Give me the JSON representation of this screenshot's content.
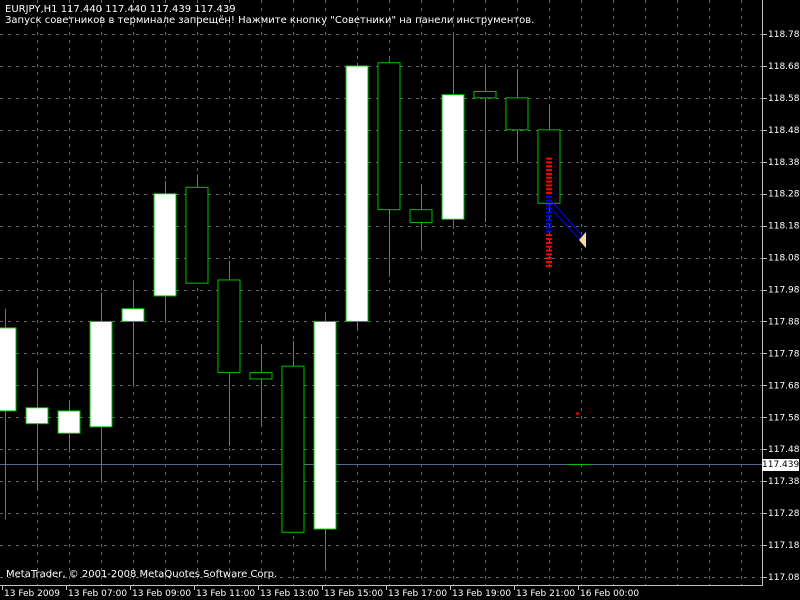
{
  "header": {
    "symbol_line": "EURJPY,H1  117.440 117.440 117.439 117.439",
    "warning": "Запуск советников в терминале запрещён! Нажмите кнопку \"Советники\" на панели инструментов."
  },
  "footer": {
    "copyright": "MetaTrader, © 2001-2008 MetaQuotes Software Corp."
  },
  "current_price": "117.439",
  "colors": {
    "background": "#000000",
    "grid": "#c0c0c0",
    "wick": "#00c000",
    "bull_body": "#ffffff",
    "bear_body": "#000000",
    "price_line": "#5a6a8a",
    "signal_red": "#ff0000",
    "signal_blue": "#0000ff",
    "signal_tan": "#ffd8a8"
  },
  "chart_data": {
    "type": "candlestick",
    "timeframe": "H1",
    "ylim": [
      117.07,
      118.82
    ],
    "y_ticks": [
      "118.785",
      "118.685",
      "118.585",
      "118.485",
      "118.385",
      "118.285",
      "118.185",
      "118.085",
      "117.985",
      "117.885",
      "117.785",
      "117.685",
      "117.585",
      "117.485",
      "117.385",
      "117.285",
      "117.185",
      "117.085"
    ],
    "x_ticks": [
      "13 Feb 2009",
      "13 Feb 07:00",
      "13 Feb 09:00",
      "13 Feb 11:00",
      "13 Feb 13:00",
      "13 Feb 15:00",
      "13 Feb 17:00",
      "13 Feb 19:00",
      "13 Feb 21:00",
      "16 Feb 00:00"
    ],
    "grid": true,
    "current_price": 117.439,
    "candles": [
      {
        "time": "13 Feb 05:00",
        "o": 117.605,
        "h": 117.925,
        "l": 117.265,
        "c": 117.865
      },
      {
        "time": "13 Feb 06:00",
        "o": 117.565,
        "h": 117.735,
        "l": 117.355,
        "c": 117.615
      },
      {
        "time": "13 Feb 07:00",
        "o": 117.535,
        "h": 117.635,
        "l": 117.475,
        "c": 117.605
      },
      {
        "time": "13 Feb 08:00",
        "o": 117.555,
        "h": 117.975,
        "l": 117.385,
        "c": 117.885
      },
      {
        "time": "13 Feb 09:00",
        "o": 117.885,
        "h": 118.005,
        "l": 117.685,
        "c": 117.925
      },
      {
        "time": "13 Feb 10:00",
        "o": 117.965,
        "h": 118.325,
        "l": 117.885,
        "c": 118.285
      },
      {
        "time": "13 Feb 11:00",
        "o": 118.305,
        "h": 118.345,
        "l": 118.005,
        "c": 118.005
      },
      {
        "time": "13 Feb 12:00",
        "o": 118.015,
        "h": 118.075,
        "l": 117.495,
        "c": 117.725
      },
      {
        "time": "13 Feb 13:00",
        "o": 117.725,
        "h": 117.815,
        "l": 117.555,
        "c": 117.705
      },
      {
        "time": "13 Feb 14:00",
        "o": 117.745,
        "h": 117.825,
        "l": 117.285,
        "c": 117.225
      },
      {
        "time": "13 Feb 15:00",
        "o": 117.235,
        "h": 117.905,
        "l": 117.105,
        "c": 117.885
      },
      {
        "time": "13 Feb 16:00",
        "o": 117.885,
        "h": 118.695,
        "l": 117.855,
        "c": 118.685
      },
      {
        "time": "13 Feb 17:00",
        "o": 118.695,
        "h": 118.705,
        "l": 118.025,
        "c": 118.235
      },
      {
        "time": "13 Feb 18:00",
        "o": 118.235,
        "h": 118.315,
        "l": 118.115,
        "c": 118.195
      },
      {
        "time": "13 Feb 19:00",
        "o": 118.205,
        "h": 118.785,
        "l": 118.175,
        "c": 118.595
      },
      {
        "time": "13 Feb 20:00",
        "o": 118.605,
        "h": 118.685,
        "l": 118.195,
        "c": 118.585
      },
      {
        "time": "13 Feb 21:00",
        "o": 118.585,
        "h": 118.675,
        "l": 118.385,
        "c": 118.485
      },
      {
        "time": "13 Feb 22:00",
        "o": 118.485,
        "h": 118.565,
        "l": 118.225,
        "c": 118.255
      }
    ]
  }
}
